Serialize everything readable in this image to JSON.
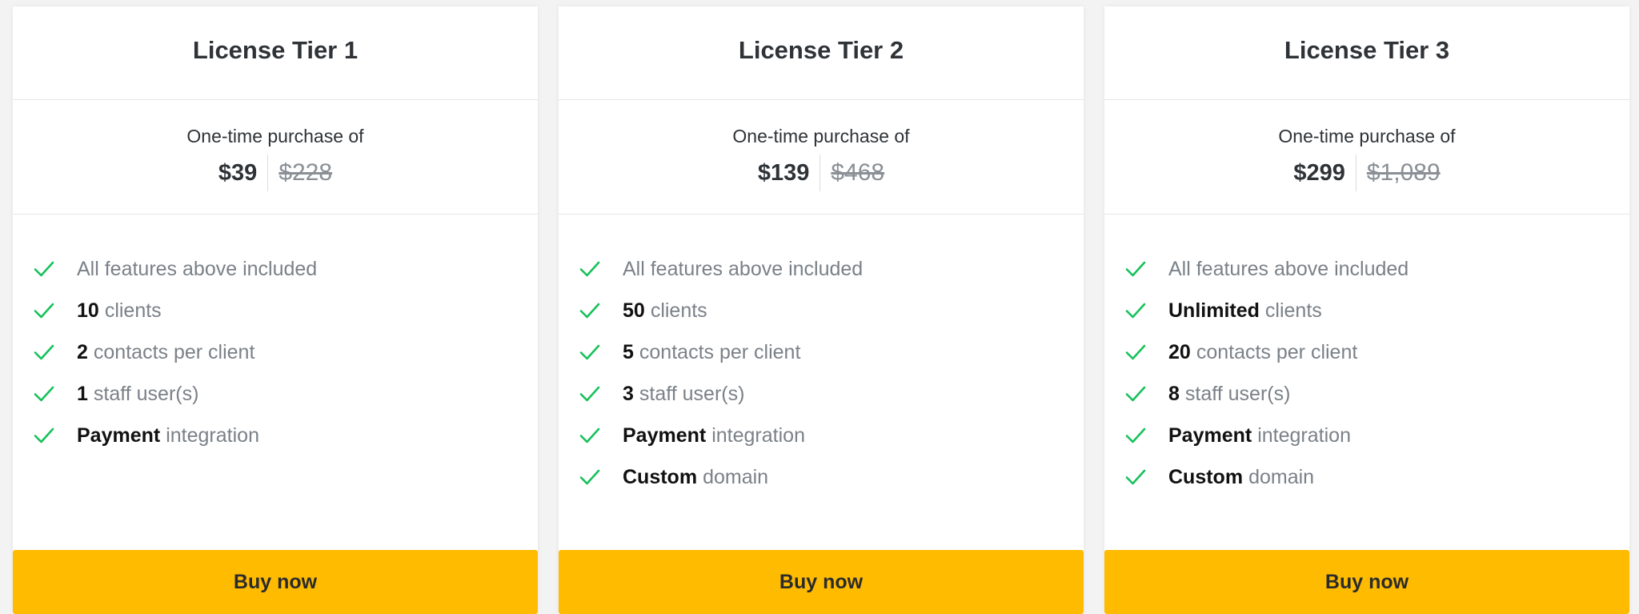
{
  "colors": {
    "accent": "#ffbb00",
    "check": "#16c15a"
  },
  "tiers": [
    {
      "title": "License Tier 1",
      "price_label": "One-time purchase of",
      "price": "$39",
      "old_price": "$228",
      "features": [
        {
          "strong": "",
          "text": "All features above included"
        },
        {
          "strong": "10",
          "text": "clients"
        },
        {
          "strong": "2",
          "text": "contacts per client"
        },
        {
          "strong": "1",
          "text": "staff user(s)"
        },
        {
          "strong": "Payment",
          "text": "integration"
        }
      ],
      "button": "Buy now"
    },
    {
      "title": "License Tier 2",
      "price_label": "One-time purchase of",
      "price": "$139",
      "old_price": "$468",
      "features": [
        {
          "strong": "",
          "text": "All features above included"
        },
        {
          "strong": "50",
          "text": "clients"
        },
        {
          "strong": "5",
          "text": "contacts per client"
        },
        {
          "strong": "3",
          "text": "staff user(s)"
        },
        {
          "strong": "Payment",
          "text": "integration"
        },
        {
          "strong": "Custom",
          "text": "domain"
        }
      ],
      "button": "Buy now"
    },
    {
      "title": "License Tier 3",
      "price_label": "One-time purchase of",
      "price": "$299",
      "old_price": "$1,089",
      "features": [
        {
          "strong": "",
          "text": "All features above included"
        },
        {
          "strong": "Unlimited",
          "text": "clients"
        },
        {
          "strong": "20",
          "text": "contacts per client"
        },
        {
          "strong": "8",
          "text": "staff user(s)"
        },
        {
          "strong": "Payment",
          "text": "integration"
        },
        {
          "strong": "Custom",
          "text": "domain"
        }
      ],
      "button": "Buy now"
    }
  ]
}
